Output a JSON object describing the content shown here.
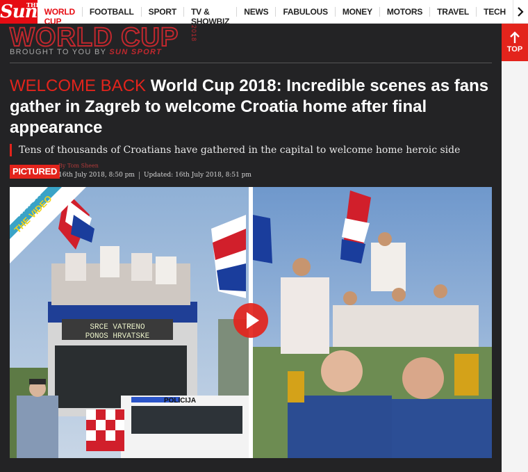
{
  "header": {
    "logo_the": "THE",
    "logo_text": "Sun",
    "nav_items": [
      {
        "label": "WORLD CUP",
        "active": true
      },
      {
        "label": "FOOTBALL"
      },
      {
        "label": "SPORT"
      },
      {
        "label": "TV & SHOWBIZ"
      },
      {
        "label": "NEWS"
      },
      {
        "label": "FABULOUS"
      },
      {
        "label": "MONEY"
      },
      {
        "label": "MOTORS"
      },
      {
        "label": "TRAVEL"
      },
      {
        "label": "TECH"
      }
    ]
  },
  "banner": {
    "title": "WORLD CUP",
    "subtitle_prefix": "BROUGHT TO YOU BY ",
    "subtitle_brand": "SUN SPORT",
    "year": "2018"
  },
  "article": {
    "kicker": "WELCOME BACK",
    "headline": "World Cup 2018: Incredible scenes as fans gather in Zagreb to welcome Croatia home after final appearance",
    "standfirst": "Tens of thousands of Croatians have gathered in the capital to welcome home heroic side",
    "badge": "PICTURED",
    "byline": "By Tom Sheen",
    "published": "16th July 2018, 8:50 pm",
    "updated": "Updated: 16th July 2018, 8:51 pm"
  },
  "video": {
    "watch_line1": "WATCH",
    "watch_line2": "THE VIDEO",
    "bus_sign_1": "SRCE VATRENO",
    "bus_sign_2": "PONOS HRVATSKE",
    "police_text": "POLICIJA"
  },
  "back_to_top": {
    "label": "TOP"
  },
  "colors": {
    "brand_red": "#e60c13",
    "panel_bg": "#232325",
    "kicker_red": "#e3241c"
  }
}
